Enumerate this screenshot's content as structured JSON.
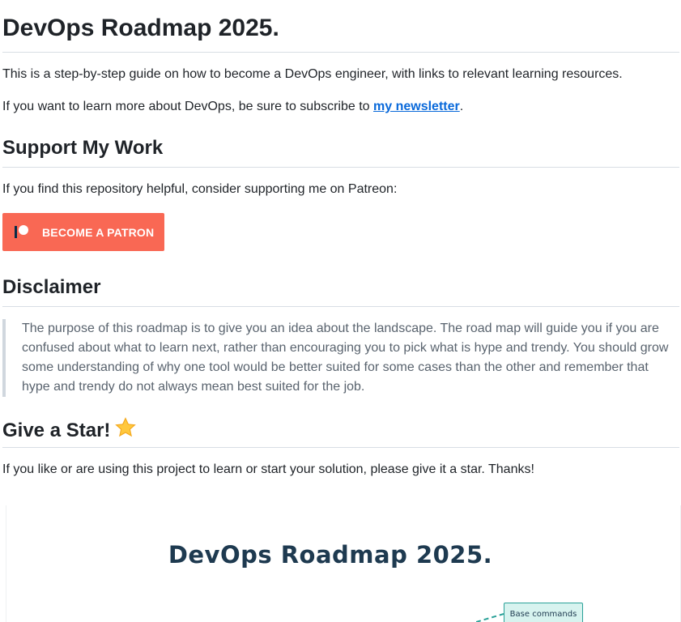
{
  "title": "DevOps Roadmap 2025.",
  "intro": "This is a step-by-step guide on how to become a DevOps engineer, with links to relevant learning resources.",
  "newsletter": {
    "before": "If you want to learn more about DevOps, be sure to subscribe to ",
    "link_text": "my newsletter",
    "after": "."
  },
  "support": {
    "heading": "Support My Work",
    "text": "If you find this repository helpful, consider supporting me on Patreon:",
    "button_label": "BECOME A PATRON"
  },
  "disclaimer": {
    "heading": "Disclaimer",
    "text": "The purpose of this roadmap is to give you an idea about the landscape. The road map will guide you if you are confused about what to learn next, rather than encouraging you to pick what is hype and trendy. You should grow some understanding of why one tool would be better suited for some cases than the other and remember that hype and trendy do not always mean best suited for the job."
  },
  "star": {
    "heading": "Give a Star!",
    "icon": "star-icon",
    "text": "If you like or are using this project to learn or start your solution, please give it a star. Thanks!"
  },
  "roadmap_image": {
    "title": "DevOps Roadmap 2025.",
    "node_label": "Base commands"
  },
  "colors": {
    "link": "#0969da",
    "patreon": "#f96854",
    "node_fill": "#d7f3ef",
    "node_border": "#2aa198"
  }
}
